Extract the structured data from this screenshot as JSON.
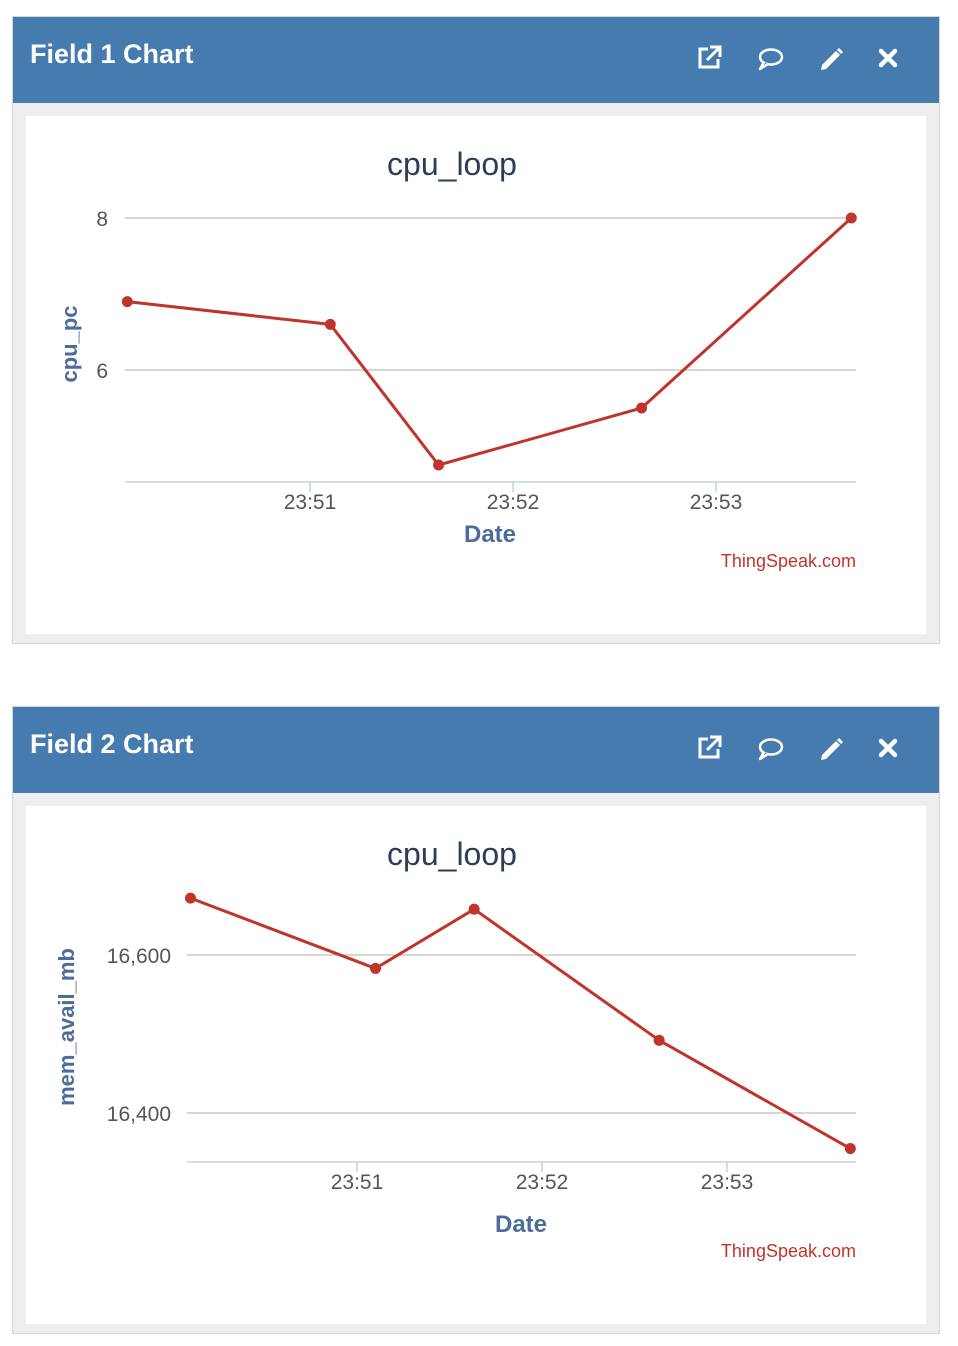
{
  "panels": [
    {
      "title": "Field 1 Chart",
      "icons": [
        "external-link-icon",
        "comment-icon",
        "pencil-icon",
        "close-icon"
      ],
      "chart_data": {
        "type": "line",
        "title": "cpu_loop",
        "xlabel": "Date",
        "ylabel": "cpu_pc",
        "x_ticks": [
          "23:51",
          "23:52",
          "23:53"
        ],
        "y_ticks": [
          "6",
          "8"
        ],
        "series": [
          {
            "x": [
              "23:50:06",
              "23:51:06",
              "23:51:38",
              "23:52:38",
              "23:53:40"
            ],
            "values": [
              6.9,
              6.6,
              4.75,
              5.5,
              8.0
            ]
          }
        ],
        "ylim": [
          4.5,
          8.0
        ],
        "grid": true,
        "credit": "ThingSpeak.com",
        "line_color": "#c0342c"
      }
    },
    {
      "title": "Field 2 Chart",
      "icons": [
        "external-link-icon",
        "comment-icon",
        "pencil-icon",
        "close-icon"
      ],
      "chart_data": {
        "type": "line",
        "title": "cpu_loop",
        "xlabel": "Date",
        "ylabel": "mem_avail_mb",
        "x_ticks": [
          "23:51",
          "23:52",
          "23:53"
        ],
        "y_ticks": [
          "16,400",
          "16,600"
        ],
        "series": [
          {
            "x": [
              "23:50:06",
              "23:51:06",
              "23:51:38",
              "23:52:38",
              "23:53:40"
            ],
            "values": [
              16672,
              16583,
              16658,
              16492,
              16355
            ]
          }
        ],
        "ylim": [
          16340,
          16700
        ],
        "grid": true,
        "credit": "ThingSpeak.com",
        "line_color": "#c0342c"
      }
    }
  ]
}
